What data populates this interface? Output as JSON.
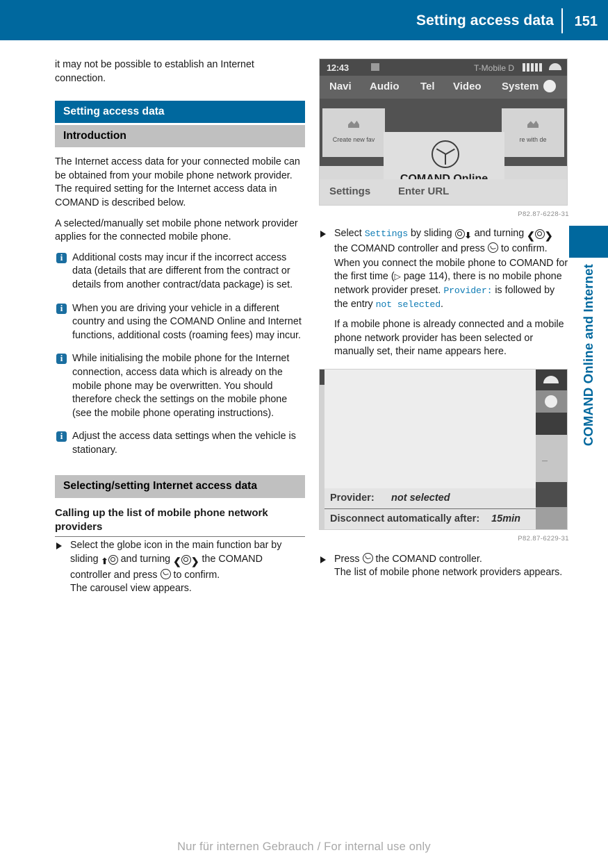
{
  "header": {
    "title": "Setting access data",
    "page_number": "151"
  },
  "side_tab": {
    "label": "COMAND Online and Internet"
  },
  "footer": {
    "text": "Nur für internen Gebrauch / For internal use only"
  },
  "left_column": {
    "lead_paragraph": "it may not be possible to establish an Internet connection.",
    "section_heading": "Setting access data",
    "subsection_heading": "Introduction",
    "intro_paragraph_1": "The Internet access data for your connected mobile can be obtained from your mobile phone network provider. The required setting for the Internet access data in COMAND is described below.",
    "intro_paragraph_2": "A selected/manually set mobile phone network provider applies for the connected mobile phone.",
    "notes": [
      "Additional costs may incur if the incorrect access data (details that are different from the contract or details from another contract/data package) is set.",
      "When you are driving your vehicle in a different country and using the COMAND Online and Internet functions, additional costs (roaming fees) may incur.",
      "While initialising the mobile phone for the Internet connection, access data which is already on the mobile phone may be overwritten. You should therefore check the settings on the mobile phone (see the mobile phone operating instructions).",
      "Adjust the access data settings when the vehicle is stationary."
    ],
    "section_heading_2": "Selecting/setting Internet access data",
    "sub_head": "Calling up the list of mobile phone network providers",
    "step_1": {
      "part_1": "Select the globe icon in the main function bar by sliding",
      "part_2": "and turning",
      "part_3": "the COMAND controller and press",
      "part_4": "to confirm.",
      "result": "The carousel view appears."
    }
  },
  "right_column": {
    "figure_1": {
      "caption": "P82.87-6228-31",
      "status_time": "12:43",
      "status_carrier": "T-Mobile D",
      "menu_items": [
        "Navi",
        "Audio",
        "Tel",
        "Video",
        "System"
      ],
      "card_left_label": "Create new fav",
      "card_right_label": "re with de",
      "dialog_label": "COMAND Online",
      "bottom_items": [
        "Settings",
        "Enter URL"
      ]
    },
    "step_1": {
      "part_1": "Select",
      "ui_settings": "Settings",
      "part_2": "by sliding",
      "part_3": "and turning",
      "part_4": "the COMAND controller and press",
      "part_5": "to confirm.",
      "body_1": "When you connect the mobile phone to COMAND for the first time (",
      "page_ref": "page 114",
      "body_2": "), there is no mobile phone network provider preset.",
      "ui_provider": "Provider:",
      "body_3": "is followed by the entry",
      "ui_not_selected": "not selected",
      "body_4": "."
    },
    "paragraph_2": "If a mobile phone is already connected and a mobile phone network provider has been selected or manually set, their name appears here.",
    "figure_2": {
      "caption": "P82.87-6229-31",
      "row_1_label": "Provider:",
      "row_1_value": "not selected",
      "row_2_label": "Disconnect automatically after:",
      "row_2_value": "15min"
    },
    "step_2": {
      "part_1": "Press",
      "part_2": "the COMAND controller.",
      "result_line_1": "The list of mobile phone network providers appears."
    }
  }
}
